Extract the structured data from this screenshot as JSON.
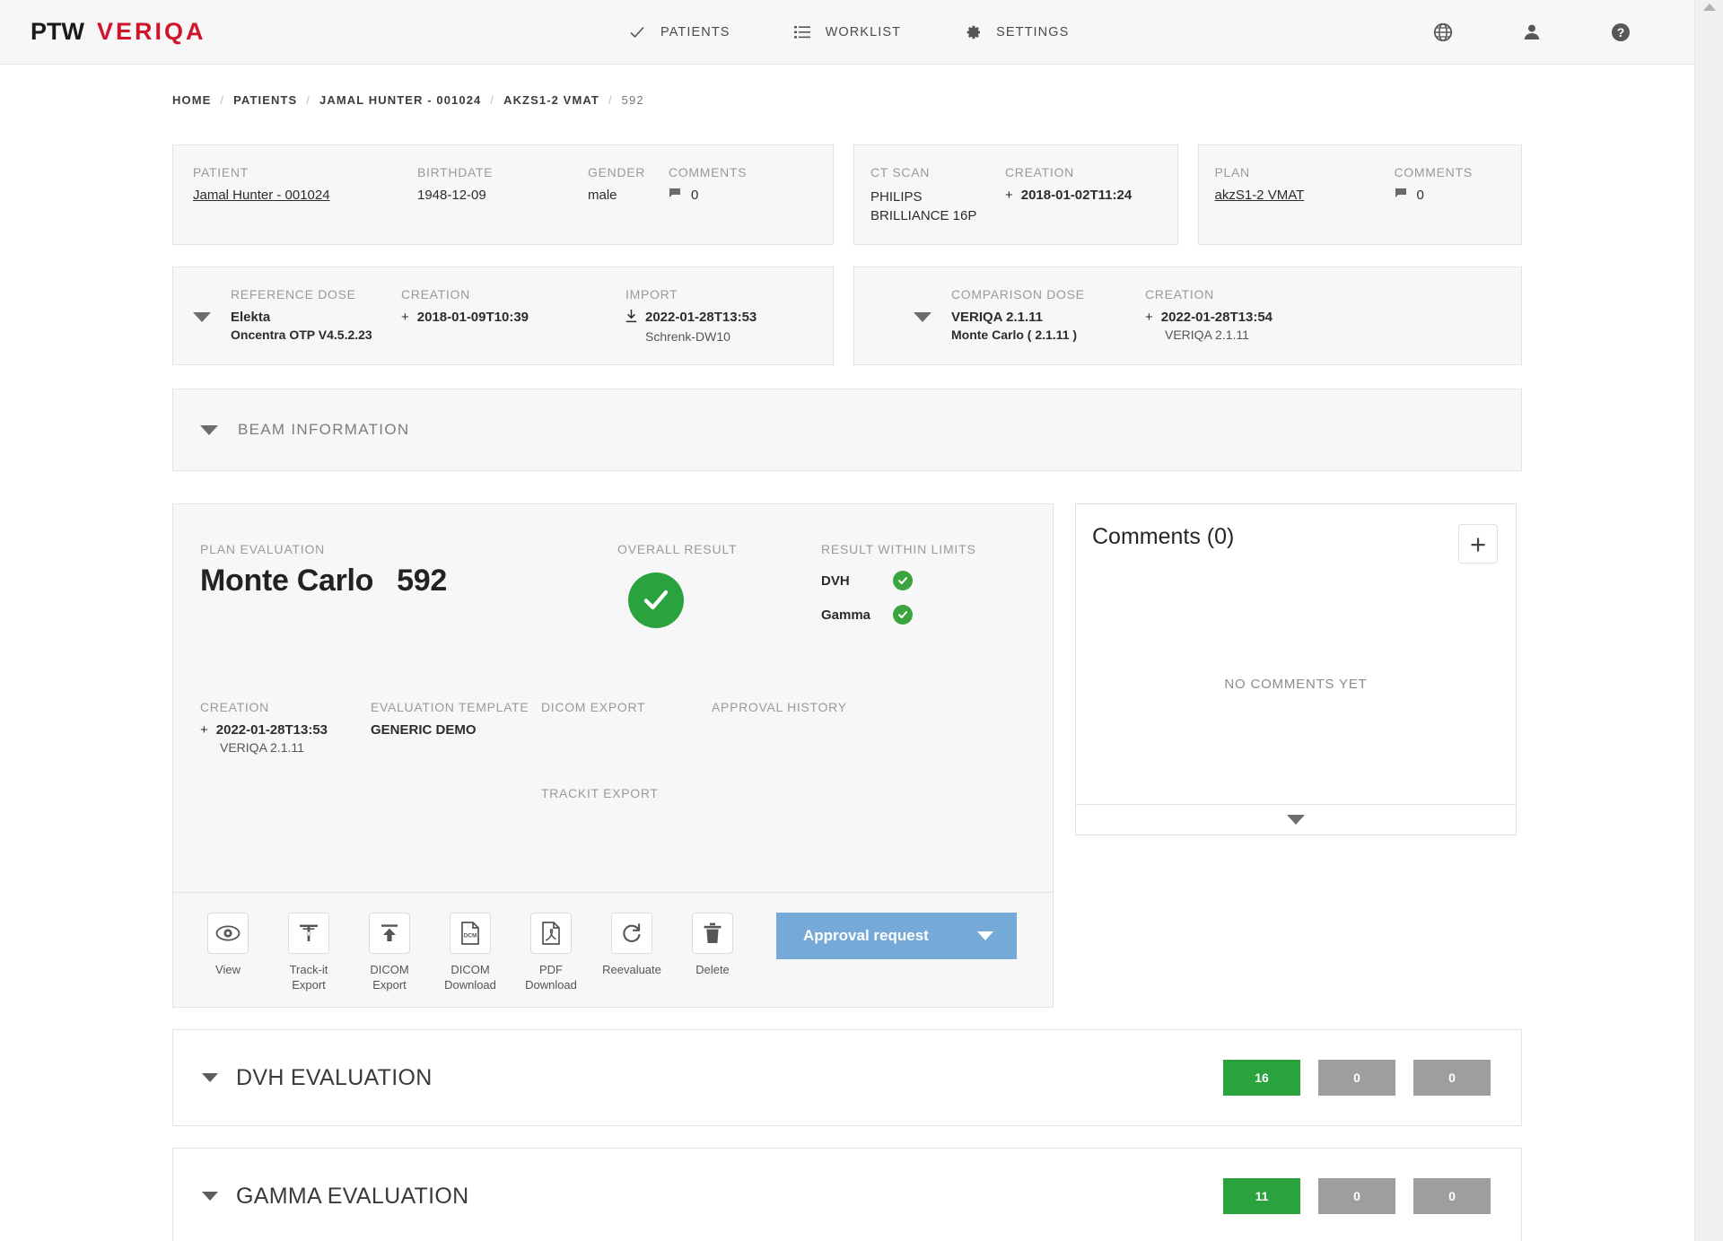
{
  "app": {
    "logo_ptw": "PTW",
    "logo_veriqa": "VERIQA"
  },
  "nav": {
    "items": [
      {
        "label": "PATIENTS",
        "icon": "check-icon"
      },
      {
        "label": "WORKLIST",
        "icon": "list-icon"
      },
      {
        "label": "SETTINGS",
        "icon": "gear-icon"
      }
    ],
    "right_icons": [
      {
        "name": "globe-icon"
      },
      {
        "name": "user-icon"
      },
      {
        "name": "help-icon"
      }
    ]
  },
  "breadcrumb": {
    "items": [
      "HOME",
      "PATIENTS",
      "JAMAL HUNTER - 001024",
      "AKZS1-2 VMAT",
      "592"
    ],
    "separator": "/"
  },
  "patient_card": {
    "patient_label": "PATIENT",
    "patient_value": "Jamal Hunter - 001024",
    "birthdate_label": "BIRTHDATE",
    "birthdate_value": "1948-12-09",
    "gender_label": "GENDER",
    "gender_value": "male",
    "comments_label": "COMMENTS",
    "comments_value": "0"
  },
  "ct_card": {
    "ct_label": "CT SCAN",
    "ct_value": "PHILIPS BRILLIANCE 16P",
    "creation_label": "CREATION",
    "creation_value": "2018-01-02T11:24"
  },
  "plan_card": {
    "plan_label": "PLAN",
    "plan_value": "akzS1-2 VMAT",
    "comments_label": "COMMENTS",
    "comments_value": "0"
  },
  "reference_dose": {
    "label": "REFERENCE DOSE",
    "value": "Elekta",
    "value_sub": "Oncentra OTP V4.5.2.23",
    "creation_label": "CREATION",
    "creation_value": "2018-01-09T10:39",
    "import_label": "IMPORT",
    "import_value": "2022-01-28T13:53",
    "import_sub": "Schrenk-DW10"
  },
  "comparison_dose": {
    "label": "COMPARISON DOSE",
    "value": "VERIQA 2.1.11",
    "value_sub": "Monte Carlo ( 2.1.11 )",
    "creation_label": "CREATION",
    "creation_value": "2022-01-28T13:54",
    "creation_sub": "VERIQA 2.1.11"
  },
  "beam_information": {
    "title": "BEAM INFORMATION"
  },
  "plan_evaluation": {
    "label": "PLAN EVALUATION",
    "title": "Monte Carlo",
    "number": "592",
    "overall_result_label": "OVERALL RESULT",
    "overall_result_status": "pass",
    "within_limits_label": "RESULT WITHIN LIMITS",
    "within_limits": [
      {
        "name": "DVH",
        "status": "pass"
      },
      {
        "name": "Gamma",
        "status": "pass"
      }
    ],
    "creation_label": "CREATION",
    "creation_value": "2022-01-28T13:53",
    "creation_sub": "VERIQA 2.1.11",
    "template_label": "EVALUATION TEMPLATE",
    "template_value": "GENERIC DEMO",
    "dicom_export_label": "DICOM EXPORT",
    "trackit_export_label": "TRACKIT EXPORT",
    "approval_history_label": "APPROVAL HISTORY",
    "tools": [
      {
        "icon": "eye-icon",
        "label": "View"
      },
      {
        "icon": "trackit-icon",
        "label": "Track-it\nExport"
      },
      {
        "icon": "upload-icon",
        "label": "DICOM\nExport"
      },
      {
        "icon": "dcm-file-icon",
        "label": "DICOM\nDownload"
      },
      {
        "icon": "pdf-file-icon",
        "label": "PDF\nDownload"
      },
      {
        "icon": "refresh-icon",
        "label": "Reevaluate"
      },
      {
        "icon": "trash-icon",
        "label": "Delete"
      }
    ],
    "approval_button": "Approval request"
  },
  "comments_panel": {
    "title": "Comments (0)",
    "add_label": "+",
    "empty_text": "NO COMMENTS YET"
  },
  "sections": [
    {
      "title": "DVH EVALUATION",
      "badges": [
        {
          "value": "16",
          "color": "green"
        },
        {
          "value": "0",
          "color": "grey"
        },
        {
          "value": "0",
          "color": "grey"
        }
      ]
    },
    {
      "title": "GAMMA EVALUATION",
      "badges": [
        {
          "value": "11",
          "color": "green"
        },
        {
          "value": "0",
          "color": "grey"
        },
        {
          "value": "0",
          "color": "grey"
        }
      ]
    }
  ],
  "colors": {
    "brand_red": "#cf142b",
    "pass_green": "#2aa33f",
    "badge_grey": "#9e9e9e",
    "accent_blue": "#74a9d8"
  }
}
